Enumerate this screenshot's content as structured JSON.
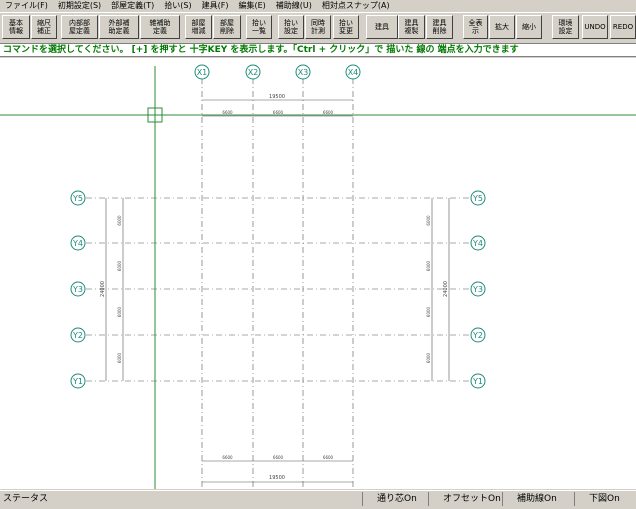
{
  "menu": [
    "ファイル(F)",
    "初期設定(S)",
    "部屋定義(T)",
    "拾い(S)",
    "建具(F)",
    "編集(E)",
    "補助線(U)",
    "相対点スナップ(A)"
  ],
  "toolbar": [
    "基本\n情報",
    "縮尺\n補正",
    "内部部\n屋定義",
    "外部補\n助定義",
    "雑補助\n定義",
    "部屋\n増減",
    "部屋\n削除",
    "拾い\n一覧",
    "拾い\n設定",
    "同時\n計測",
    "拾い\n変更",
    "建具",
    "建具\n複製",
    "建具\n削除",
    "全表\n示",
    "拡大",
    "縮小",
    "環境\n設定",
    "UNDO",
    "REDO"
  ],
  "prompt": "コマンドを選択してください。  [+] を押すと 十字KEY を表示します。「Ctrl + クリック」で 描いた 線の 端点を入力できます",
  "grid": {
    "x_axes": [
      "X1",
      "X2",
      "X3",
      "X4"
    ],
    "y_axes": [
      "Y5",
      "Y4",
      "Y3",
      "Y2",
      "Y1"
    ],
    "top_total": "19500",
    "top_spans": [
      "6600",
      "6600",
      "6600"
    ],
    "bottom_spans": [
      "6600",
      "6600",
      "6600"
    ],
    "bottom_total": "19500",
    "left_total": "24000",
    "left_spans": [
      "6000",
      "6000",
      "6000",
      "6000"
    ],
    "right_total": "24000",
    "right_spans": [
      "6000",
      "6000",
      "6000",
      "6000"
    ]
  },
  "status": {
    "label": "ステータス",
    "grid_core": "通り芯On",
    "offset": "オフセットOn",
    "aux_line": "補助線On",
    "underlay": "下図On"
  },
  "colors": {
    "prompt_text": "#007a00",
    "cursor": "#2e8b3a",
    "axis_bubble": "#1e8a7a",
    "grid_line": "#555555"
  }
}
